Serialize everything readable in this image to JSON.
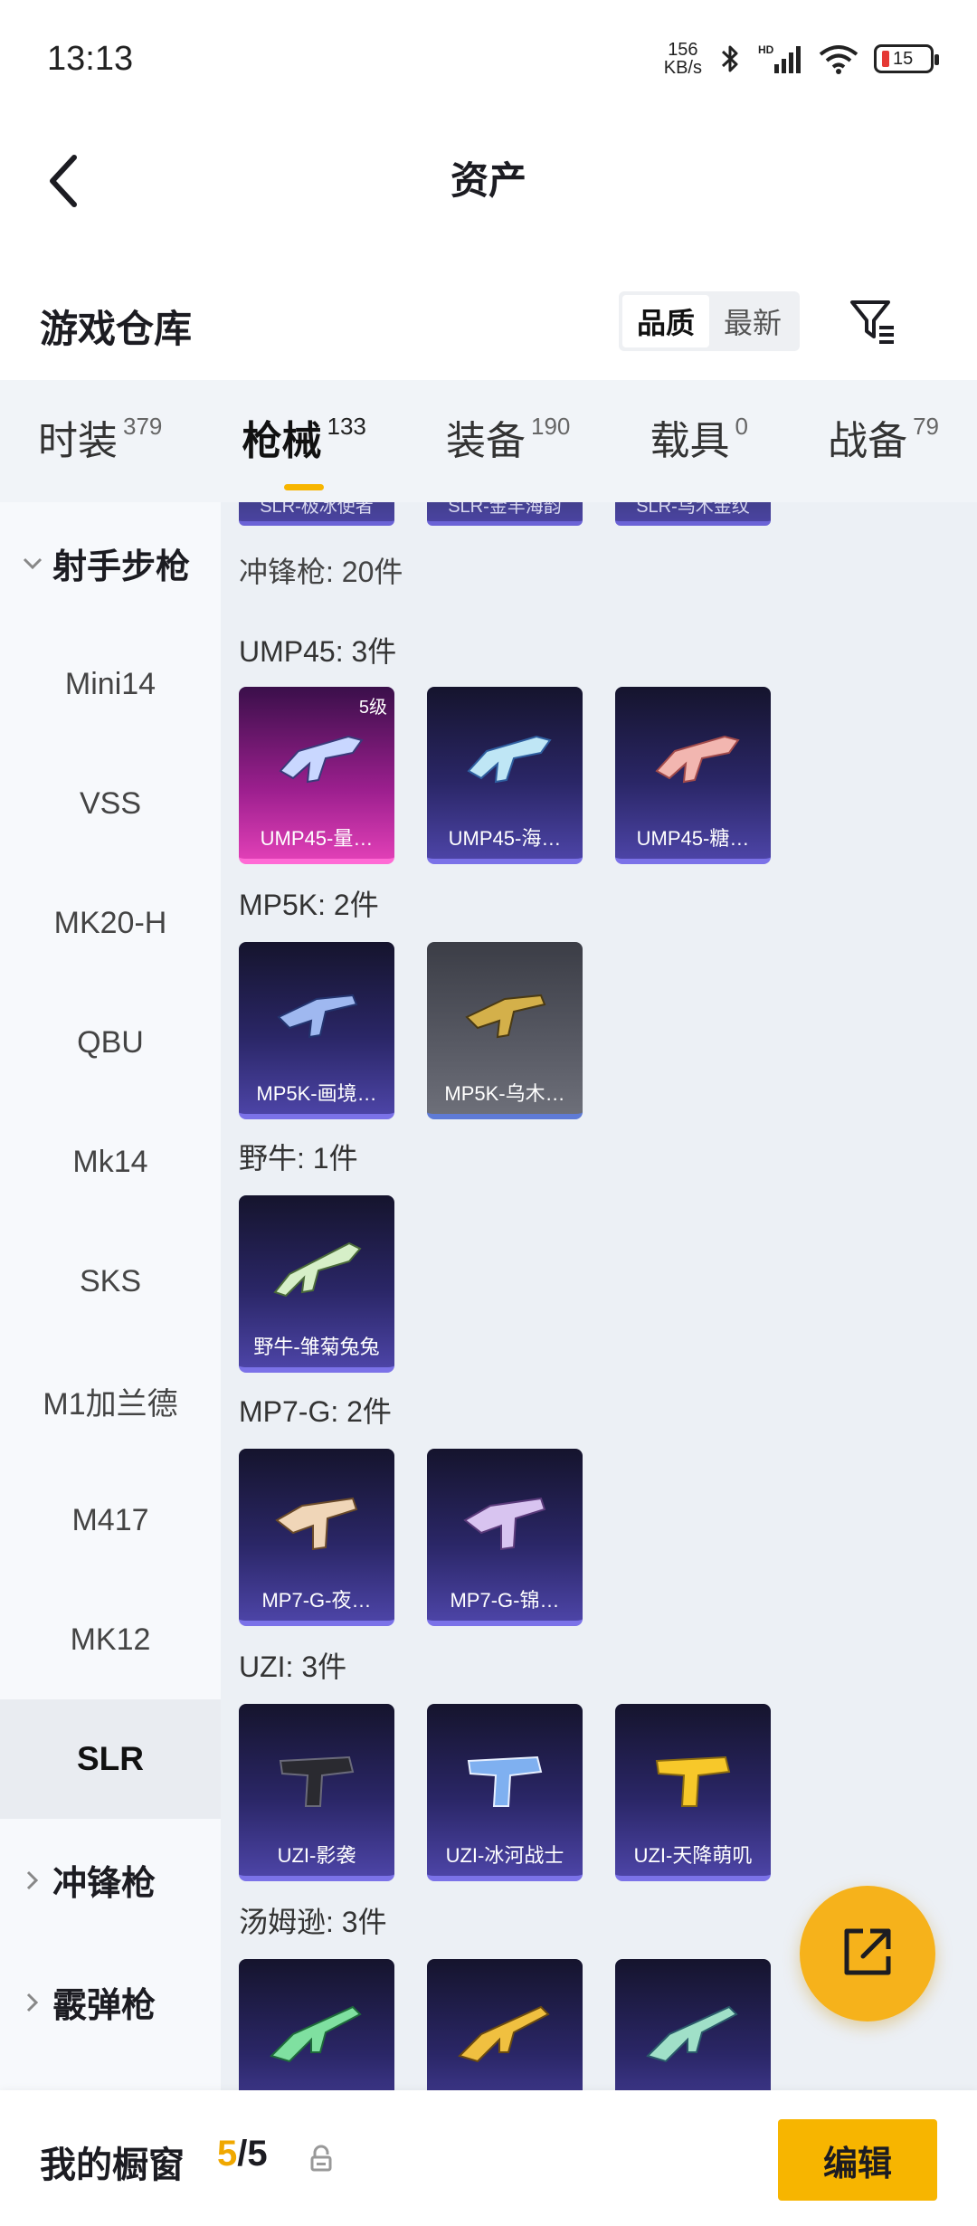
{
  "status_bar": {
    "time": "13:13",
    "net_speed_value": "156",
    "net_speed_unit": "KB/s",
    "battery": "15",
    "icons": [
      "bluetooth-icon",
      "hd-signal-icon",
      "wifi-icon",
      "battery-icon"
    ]
  },
  "header": {
    "title": "资产",
    "back_icon": "chevron-left-icon"
  },
  "warehouse": {
    "title": "游戏仓库",
    "sort_options": [
      "品质",
      "最新"
    ],
    "active_sort": "品质",
    "filter_icon": "filter-icon"
  },
  "category_tabs": [
    {
      "label": "时装",
      "count": "379"
    },
    {
      "label": "枪械",
      "count": "133",
      "active": true
    },
    {
      "label": "装备",
      "count": "190"
    },
    {
      "label": "载具",
      "count": "0"
    },
    {
      "label": "战备",
      "count": "79"
    }
  ],
  "sidebar": {
    "group_open": "射手步枪",
    "items": [
      "Mini14",
      "VSS",
      "MK20-H",
      "QBU",
      "Mk14",
      "SKS",
      "M1加兰德",
      "M417",
      "MK12",
      "SLR"
    ],
    "active_item": "SLR",
    "collapsed_groups": [
      "冲锋枪",
      "霰弹枪"
    ]
  },
  "content": {
    "top_partial_cards": [
      "SLR-极冰使者",
      "SLR-金羊海韵",
      "SLR-乌木金纹"
    ],
    "section_title": "冲锋枪: 20件",
    "groups": [
      {
        "title": "UMP45: 3件",
        "cards": [
          {
            "name": "UMP45-量…",
            "badge": "5级",
            "style": "pink"
          },
          {
            "name": "UMP45-海…",
            "style": "purple"
          },
          {
            "name": "UMP45-糖…",
            "style": "purple"
          }
        ]
      },
      {
        "title": "MP5K: 2件",
        "cards": [
          {
            "name": "MP5K-画境…",
            "style": "purple"
          },
          {
            "name": "MP5K-乌木…",
            "style": "grey"
          }
        ]
      },
      {
        "title": "野牛: 1件",
        "cards": [
          {
            "name": "野牛-雏菊兔兔",
            "style": "purple"
          }
        ]
      },
      {
        "title": "MP7-G: 2件",
        "cards": [
          {
            "name": "MP7-G-夜…",
            "style": "purple"
          },
          {
            "name": "MP7-G-锦…",
            "style": "purple"
          }
        ]
      },
      {
        "title": "UZI: 3件",
        "cards": [
          {
            "name": "UZI-影袭",
            "style": "purple"
          },
          {
            "name": "UZI-冰河战士",
            "style": "purple"
          },
          {
            "name": "UZI-天降萌叽",
            "style": "purple"
          }
        ]
      },
      {
        "title": "汤姆逊: 3件",
        "cards": [
          {
            "name": "",
            "style": "purple"
          },
          {
            "name": "",
            "style": "purple"
          },
          {
            "name": "",
            "style": "purple"
          }
        ]
      }
    ]
  },
  "fab": {
    "icon": "share-external-icon"
  },
  "bottom_bar": {
    "label": "我的橱窗",
    "count_current": "5",
    "count_total": "/5",
    "lock_icon": "lock-icon",
    "edit_label": "编辑"
  },
  "colors": {
    "accent": "#f7b500",
    "fab": "#f6b21b",
    "pink_card": "#e03fb6",
    "purple_card": "#4c44a6"
  }
}
